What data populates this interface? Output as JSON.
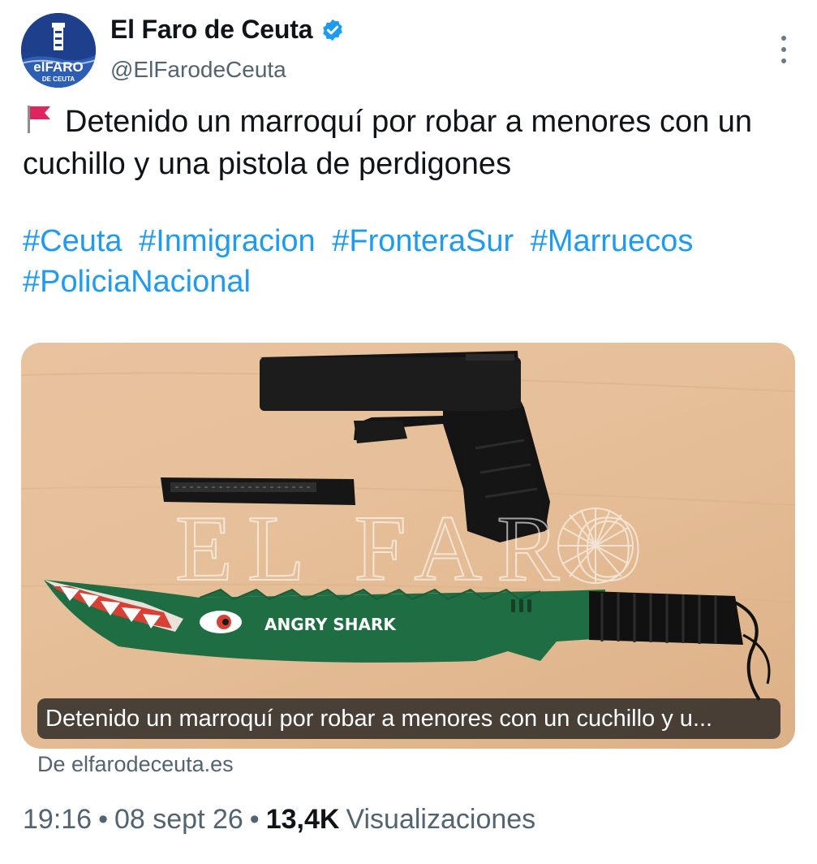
{
  "author": {
    "display_name": "El Faro de Ceuta",
    "handle": "@ElFarodeCeuta",
    "avatar_text_main": "elFARO",
    "avatar_text_sub": "DE CEUTA"
  },
  "tweet": {
    "text": "Detenido un marroquí por robar a menores con un cuchillo y una pistola de perdigones",
    "hashtags": [
      "#Ceuta",
      "#Inmigracion",
      "#FronteraSur",
      "#Marruecos",
      "#PoliciaNacional"
    ]
  },
  "media": {
    "watermark": "EL FARO",
    "knife_text": "ANGRY SHARK",
    "caption": "Detenido un marroquí por robar a menores con un cuchillo y u...",
    "source": "De elfarodeceuta.es"
  },
  "meta": {
    "time": "19:16",
    "date": "08 sept 26",
    "views_count": "13,4K",
    "views_label": "Visualizaciones",
    "separator": "•"
  },
  "colors": {
    "link": "#1d9bf0",
    "secondary_text": "#536471",
    "verified": "#1d9bf0",
    "flag": "#e0245e"
  },
  "icons": [
    "verified-badge-icon",
    "more-options-icon",
    "red-flag-icon"
  ]
}
